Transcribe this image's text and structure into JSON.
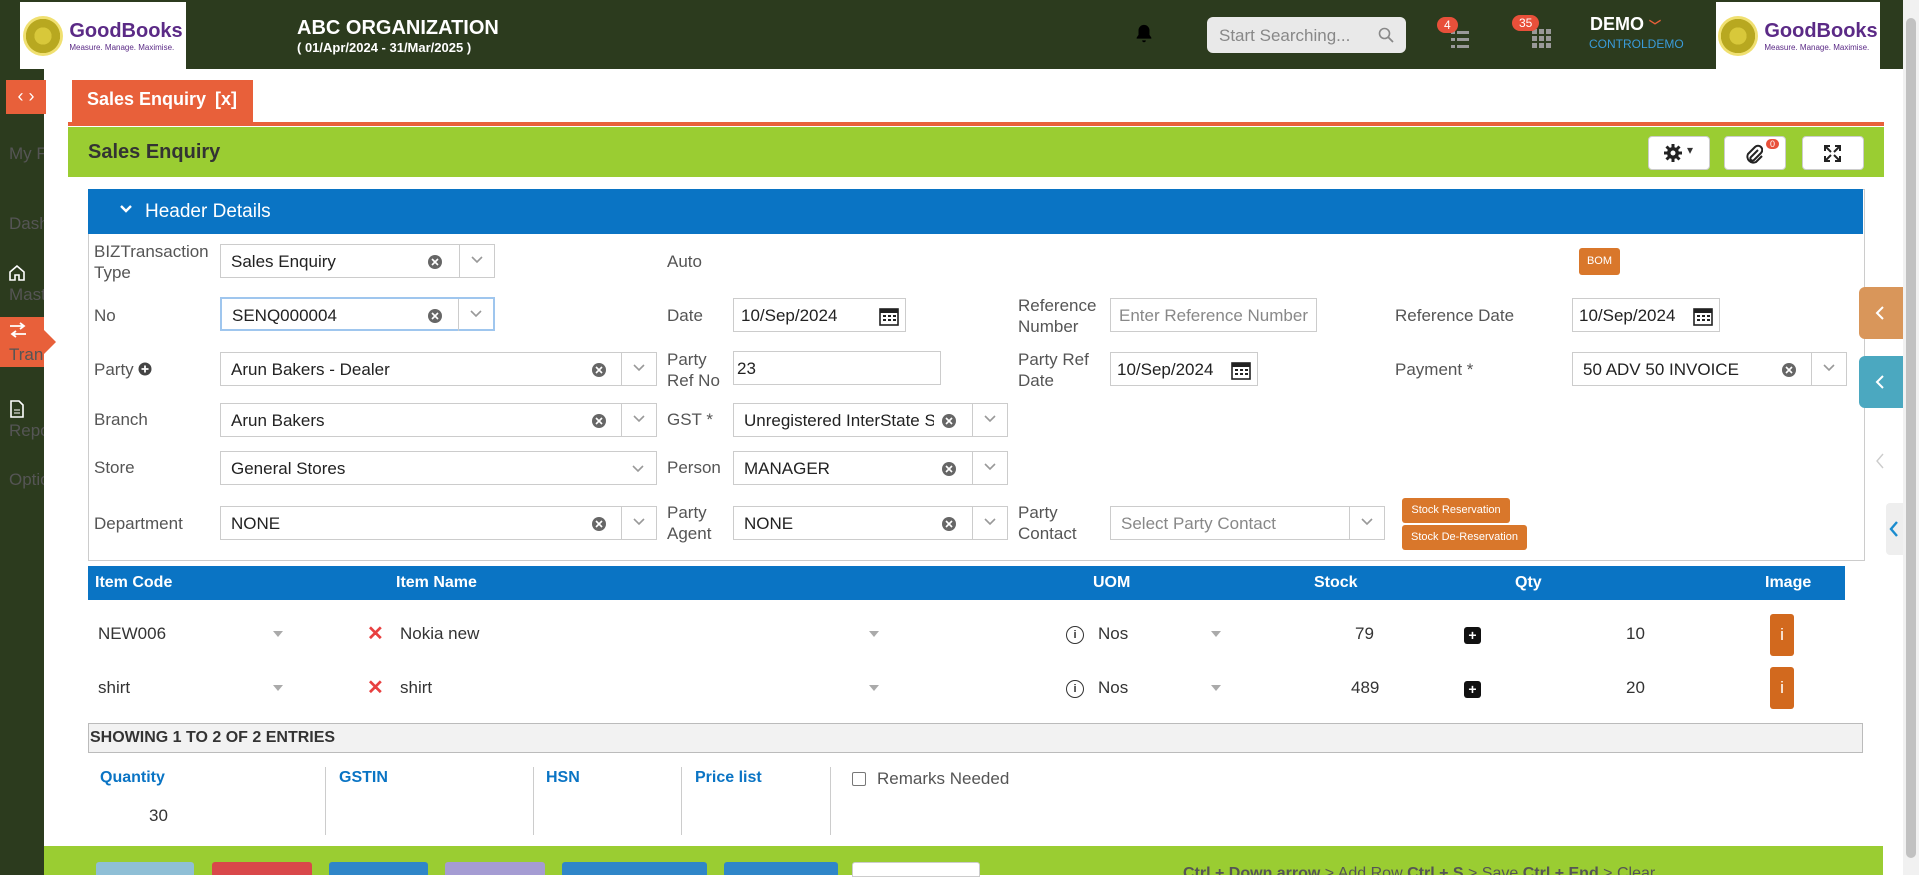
{
  "topbar": {
    "logo_brand": "GoodBooks",
    "logo_tagline": "Measure. Manage. Maximise.",
    "org_name": "ABC ORGANIZATION",
    "org_period": "( 01/Apr/2024 - 31/Mar/2025 )",
    "search_placeholder": "Start Searching...",
    "badge_tasks": "4",
    "badge_apps": "35",
    "user_name": "DEMO",
    "user_sub": "CONTROLDEMO"
  },
  "sidebar": {
    "toggle": "‹ ›",
    "items": [
      {
        "label": "My Favo"
      },
      {
        "label": "Dash"
      },
      {
        "label": "Mast"
      },
      {
        "label": "Tran"
      },
      {
        "label": "Repo"
      },
      {
        "label": "Optio"
      }
    ]
  },
  "tab": {
    "label": "Sales Enquiry",
    "close": "[x]"
  },
  "page": {
    "title": "Sales Enquiry",
    "attach_count": "0"
  },
  "header": {
    "section_title": "Header Details",
    "fields": {
      "biz_label": "BIZTransaction Type",
      "biz_value": "Sales Enquiry",
      "auto_label": "Auto",
      "bom_button": "BOM",
      "no_label": "No",
      "no_value": "SENQ000004",
      "date_label": "Date",
      "date_value": "10/Sep/2024",
      "refnum_label": "Reference Number",
      "refnum_placeholder": "Enter Reference Number",
      "refdate_label": "Reference Date",
      "refdate_value": "10/Sep/2024",
      "party_label": "Party",
      "party_value": "Arun Bakers - Dealer",
      "partyref_label": "Party Ref No",
      "partyref_value": "23",
      "partyrefdate_label": "Party Ref Date",
      "partyrefdate_value": "10/Sep/2024",
      "payment_label": "Payment *",
      "payment_value": "50 ADV 50 INVOICE",
      "branch_label": "Branch",
      "branch_value": "Arun Bakers",
      "gst_label": "GST *",
      "gst_value": "Unregistered InterState Sa",
      "store_label": "Store",
      "store_value": "General Stores",
      "person_label": "Person",
      "person_value": "MANAGER",
      "dept_label": "Department",
      "dept_value": "NONE",
      "agent_label": "Party Agent",
      "agent_value": "NONE",
      "contact_label": "Party Contact",
      "contact_placeholder": "Select Party Contact",
      "stock_res": "Stock Reservation",
      "stock_dres": "Stock De-Reservation"
    }
  },
  "items_table": {
    "columns": [
      "Item Code",
      "Item Name",
      "UOM",
      "Stock",
      "Qty",
      "Image"
    ],
    "rows": [
      {
        "code": "NEW006",
        "name": "Nokia new",
        "uom": "Nos",
        "stock": "79",
        "qty": "10",
        "image": "i"
      },
      {
        "code": "shirt",
        "name": "shirt",
        "uom": "Nos",
        "stock": "489",
        "qty": "20",
        "image": "i"
      }
    ],
    "showing": "SHOWING 1 TO 2 OF 2 ENTRIES"
  },
  "footer": {
    "quantity_label": "Quantity",
    "quantity_value": "30",
    "gstin_label": "GSTIN",
    "hsn_label": "HSN",
    "pricelist_label": "Price list",
    "remarks_label": "Remarks Needed",
    "shortcut_text_1": "Ctrl + Down arrow",
    "shortcut_text_2": " > Add Row ",
    "shortcut_text_3": "Ctrl + S",
    "shortcut_text_4": " > Save ",
    "shortcut_text_5": "Ctrl + End",
    "shortcut_text_6": " > Clear"
  },
  "colors": {
    "topbar": "#2c3b1e",
    "accent_orange": "#e8603a",
    "green": "#9acd32",
    "blue": "#0a74c4"
  }
}
